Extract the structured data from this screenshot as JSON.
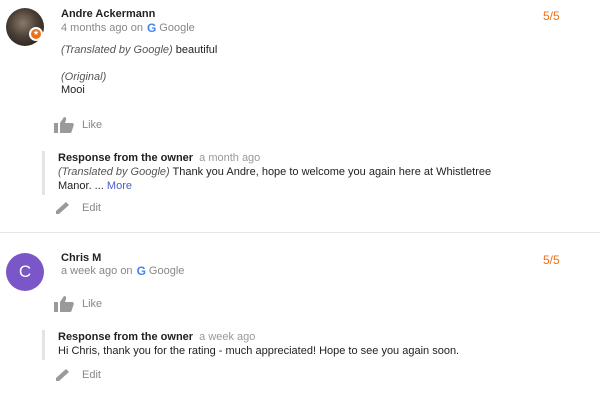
{
  "reviews": [
    {
      "name": "Andre Ackermann",
      "time": "4 months ago on",
      "source": "Google",
      "rating": "5/5",
      "translated_label": "(Translated by Google)",
      "translated_text": "beautiful",
      "original_label": "(Original)",
      "original_text": "Mooi",
      "like_label": "Like",
      "response": {
        "title": "Response from the owner",
        "time": "a month ago",
        "translated_label": "(Translated by Google)",
        "text_line1": "Thank you Andre, hope to welcome you again here at Whistletree",
        "text_line2": "Manor. ...",
        "more_label": "More",
        "edit_label": "Edit"
      }
    },
    {
      "name": "Chris M",
      "avatar_letter": "C",
      "time": "a week ago on",
      "source": "Google",
      "rating": "5/5",
      "like_label": "Like",
      "response": {
        "title": "Response from the owner",
        "time": "a week ago",
        "text": "Hi Chris, thank you for the rating - much appreciated! Hope to see you again soon.",
        "edit_label": "Edit"
      }
    }
  ],
  "colors": {
    "rating": "#e8711c",
    "avatar_c": "#7b56c9",
    "link": "#4c5ec6"
  },
  "icons": [
    "thumbs-up-icon",
    "pencil-icon",
    "google-logo-icon",
    "local-guide-badge-icon"
  ]
}
